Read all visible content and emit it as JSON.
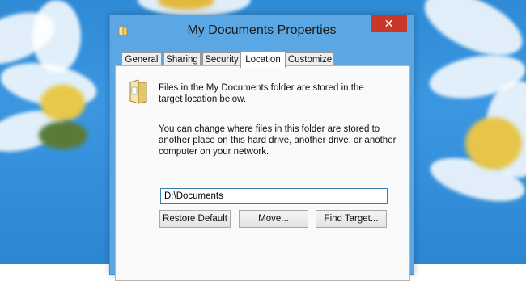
{
  "window": {
    "title": "My Documents Properties",
    "close_glyph": "✕"
  },
  "tabs": [
    {
      "label": "General"
    },
    {
      "label": "Sharing"
    },
    {
      "label": "Security"
    },
    {
      "label": "Location"
    },
    {
      "label": "Customize"
    }
  ],
  "active_tab": "Location",
  "location": {
    "description": "Files in the My Documents folder are stored in the target location below.",
    "description_line1": "Files in the My Documents folder are stored in the",
    "description_line2": "target location below.",
    "help_line1": "You can change where files in this folder are stored to",
    "help_line2": "another place on this hard drive, another drive, or another",
    "help_line3": "computer on your network.",
    "path_value": "D:\\Documents"
  },
  "buttons": {
    "restore_default": "Restore Default",
    "move": "Move...",
    "find_target": "Find Target..."
  },
  "icons": {
    "title": "folder-icon",
    "content": "folder-icon",
    "close": "close-icon"
  },
  "colors": {
    "close_button": "#c7382b",
    "window_frame": "#5aa7e3",
    "desktop": "#2f8bd6"
  }
}
